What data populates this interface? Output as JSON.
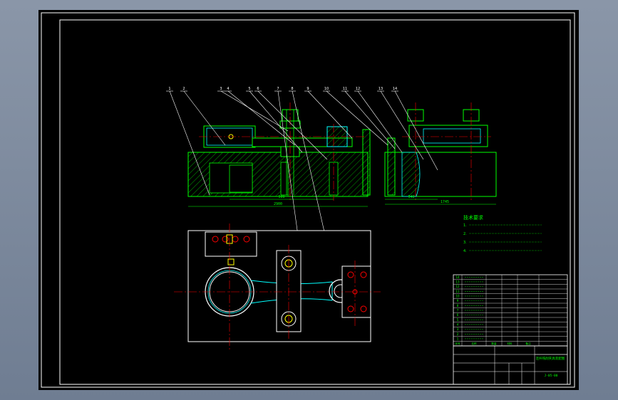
{
  "drawing": {
    "balloons": [
      "1",
      "2",
      "3",
      "4",
      "5",
      "6",
      "7",
      "8",
      "9",
      "10",
      "11",
      "12",
      "13",
      "14"
    ],
    "dimensions": [
      "900",
      "2900",
      "940",
      "1745"
    ],
    "tech_requirements": {
      "heading": "技术要求",
      "lines": [
        "1.",
        "2.",
        "3.",
        "4."
      ]
    },
    "parts_list": {
      "header": [
        "序号",
        "名称",
        "数量",
        "材料",
        "备注"
      ],
      "numbers": [
        "14",
        "13",
        "12",
        "11",
        "10",
        "9",
        "8",
        "7",
        "6",
        "5",
        "4",
        "3",
        "2",
        "1"
      ]
    },
    "title_block": {
      "title": "连杆铣削夹具装配图",
      "drawing_no": "J-05-00"
    },
    "colors": {
      "background": "#000000",
      "frame": "#ffffff",
      "outline": "#00ff00",
      "section": "#00ffff",
      "centerline": "#ff0000",
      "leader": "#ffffff",
      "text": "#00ff00"
    }
  }
}
